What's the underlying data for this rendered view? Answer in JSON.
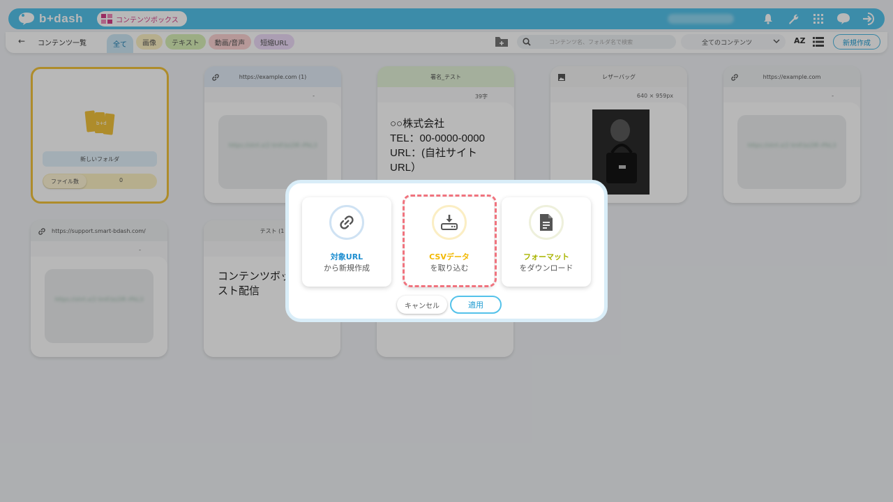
{
  "app": {
    "logo_text": "b+dash",
    "section": "コンテンツボックス"
  },
  "header": {
    "icons": [
      "bell-icon",
      "wrench-icon",
      "apps-grid-icon",
      "chat-support-icon",
      "logout-icon"
    ]
  },
  "subbar": {
    "back_icon": "←",
    "breadcrumb": "コンテンツ一覧",
    "tabs": [
      {
        "label": "全て",
        "active": true
      },
      {
        "label": "画像"
      },
      {
        "label": "テキスト"
      },
      {
        "label": "動画/音声"
      },
      {
        "label": "短縮URL"
      }
    ],
    "search_placeholder": "コンテンツ名、フォルダ名で検索",
    "filter_selected": "全てのコンテンツ",
    "sort_label": "AZ",
    "new_button": "新規作成"
  },
  "cards": {
    "folder": {
      "name": "新しいフォルダ",
      "count_label": "ファイル数",
      "count_value": "0"
    },
    "c1": {
      "title": "https://example.com (1)",
      "meta": "-",
      "blur_text": "https://shrt.x/2 tmlf.bz2lR rPkL3"
    },
    "c2": {
      "title": "署名_テスト",
      "meta": "39字",
      "text1": "○○株式会社",
      "text2": "TEL：00-0000-0000",
      "text3": "URL：(自社サイト",
      "text4": "URL）"
    },
    "c3": {
      "title": "レザーバッグ",
      "meta": "640 × 959px"
    },
    "c4": {
      "title": "https://example.com",
      "meta": "-",
      "blur_text": "https://shrt.x/2 tmlf.bz2lR rPkL3"
    },
    "c5": {
      "title": "https://support.smart-bdash.com/",
      "meta": "-",
      "blur_text": "https://shrt.x/2 tmlf.bz2lR rPkL3"
    },
    "c6": {
      "title": "テスト (1",
      "text1": "コンテンツボッ",
      "text2": "スト配信"
    }
  },
  "modal": {
    "options": [
      {
        "title": "対象URL",
        "subtitle": "から新規作成",
        "icon": "link-icon"
      },
      {
        "title": "CSVデータ",
        "subtitle": "を取り込む",
        "icon": "download-icon"
      },
      {
        "title": "フォーマット",
        "subtitle": "をダウンロード",
        "icon": "document-icon"
      }
    ],
    "cancel": "キャンセル",
    "apply": "適用"
  },
  "colors": {
    "brand": "#54c2ea",
    "highlight": "#f0737e",
    "folder_border": "#f1c23c"
  }
}
